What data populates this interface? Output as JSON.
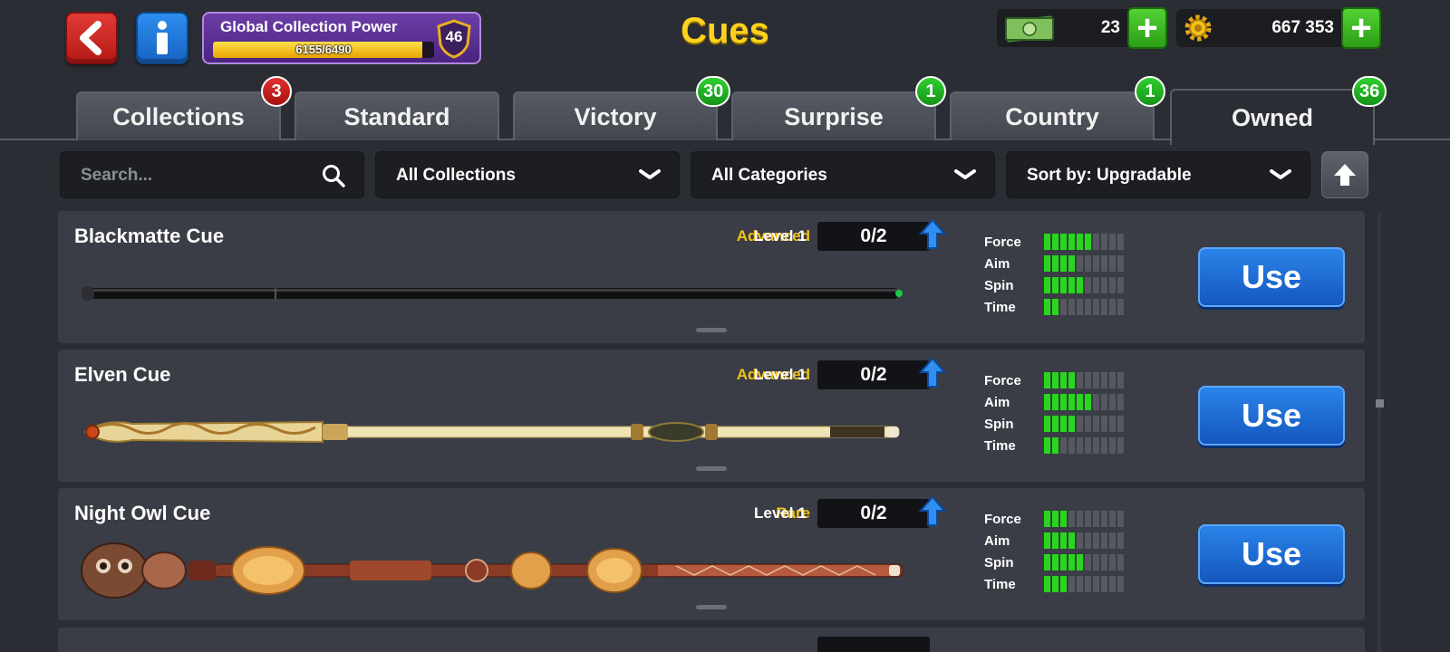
{
  "header": {
    "title": "Cues",
    "collection_power": {
      "label": "Global Collection Power",
      "current": 6155,
      "max": 6490,
      "text": "6155/6490",
      "level": "46"
    },
    "cash": "23",
    "coins": "667 353"
  },
  "tabs": [
    {
      "label": "Collections",
      "badge": "3",
      "badge_color": "#d42020"
    },
    {
      "label": "Standard",
      "badge": ""
    },
    {
      "label": "Victory",
      "badge": "30",
      "badge_color": "#22b622"
    },
    {
      "label": "Surprise",
      "badge": "1",
      "badge_color": "#22b622"
    },
    {
      "label": "Country",
      "badge": "1",
      "badge_color": "#22b622"
    },
    {
      "label": "Owned",
      "badge": "36",
      "badge_color": "#22b622",
      "active": true
    }
  ],
  "filters": {
    "search_placeholder": "Search...",
    "collections": "All Collections",
    "categories": "All Categories",
    "sort": "Sort by: Upgradable"
  },
  "cues": [
    {
      "name": "Blackmatte Cue",
      "rarity": "Advanced",
      "rarity_color": "#f2c21b",
      "level": "Level 1",
      "progress": "0/2",
      "stats": [
        {
          "label": "Force",
          "value": 6
        },
        {
          "label": "Aim",
          "value": 4
        },
        {
          "label": "Spin",
          "value": 5
        },
        {
          "label": "Time",
          "value": 2
        }
      ],
      "action": "Use"
    },
    {
      "name": "Elven Cue",
      "rarity": "Advanced",
      "rarity_color": "#f2c21b",
      "level": "Level 1",
      "progress": "0/2",
      "stats": [
        {
          "label": "Force",
          "value": 4
        },
        {
          "label": "Aim",
          "value": 6
        },
        {
          "label": "Spin",
          "value": 4
        },
        {
          "label": "Time",
          "value": 2
        }
      ],
      "action": "Use"
    },
    {
      "name": "Night Owl Cue",
      "rarity": "Rare",
      "rarity_color": "#f2c21b",
      "level": "Level 1",
      "progress": "0/2",
      "stats": [
        {
          "label": "Force",
          "value": 3
        },
        {
          "label": "Aim",
          "value": 4
        },
        {
          "label": "Spin",
          "value": 5
        },
        {
          "label": "Time",
          "value": 3
        }
      ],
      "action": "Use"
    }
  ],
  "stat_max": 10,
  "colors": {
    "accent": "#ffd31d",
    "stat_on": "#28d61e",
    "use_button": "#1f6fd8"
  }
}
